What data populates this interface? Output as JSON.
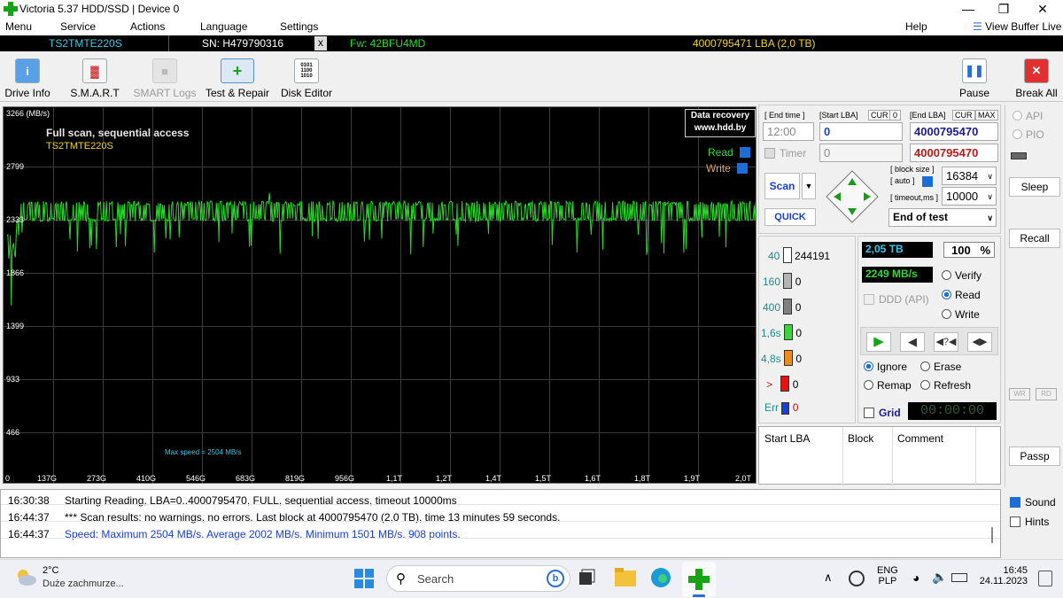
{
  "window": {
    "title": "Victoria 5.37 HDD/SSD | Device 0"
  },
  "menu": {
    "items": [
      "Menu",
      "Service",
      "Actions",
      "Language",
      "Settings"
    ],
    "help": "Help",
    "view_buffer": "View Buffer Live"
  },
  "device": {
    "model": "TS2TMTE220S",
    "serial": "SN: H479790316",
    "close": "x",
    "firmware": "Fw: 42BFU4MD",
    "capacity": "4000795471 LBA (2,0 TB)"
  },
  "toolbar": {
    "drive_info": "Drive Info",
    "smart": "S.M.A.R.T",
    "smart_logs": "SMART Logs",
    "test_repair": "Test & Repair",
    "disk_editor": "Disk Editor",
    "pause": "Pause",
    "break_all": "Break All"
  },
  "graph": {
    "unit_label": "3266 (MB/s)",
    "title": "Full scan, sequential access",
    "device": "TS2TMTE220S",
    "ad_line1": "Data recovery",
    "ad_line2": "www.hdd.by",
    "read_label": "Read",
    "write_label": "Write",
    "max_speed": "Max speed = 2504 MB/s",
    "y_ticks": [
      "2799",
      "2333",
      "1866",
      "1399",
      "933",
      "466"
    ],
    "x_ticks": [
      "0",
      "137G",
      "273G",
      "410G",
      "546G",
      "683G",
      "819G",
      "956G",
      "1,1T",
      "1,2T",
      "1,4T",
      "1,5T",
      "1,6T",
      "1,8T",
      "1,9T",
      "2,0T"
    ]
  },
  "chart_data": {
    "type": "line",
    "title": "Full scan, sequential access",
    "ylabel": "MB/s",
    "ylim": [
      0,
      3266
    ],
    "xlabel": "",
    "series": [
      {
        "name": "Read",
        "typical_min": 2250,
        "typical_max": 2430,
        "min": 1501,
        "max": 2504,
        "average": 2002,
        "points": 908
      }
    ]
  },
  "controls": {
    "end_time_label": "[ End time ]",
    "start_lba_label": "[Start LBA]",
    "cur_label": "CUR",
    "cur_value": "0",
    "end_lba_label": "[End LBA]",
    "cur2_label": "CUR",
    "max_label": "MAX",
    "end_time": "12:00",
    "start_lba": "0",
    "end_lba": "4000795470",
    "timer_label": "Timer",
    "timer_value": "0",
    "end_lba2": "4000795470",
    "block_size_label": "[ block size ]",
    "auto_label": "[ auto ]",
    "block_size": "16384",
    "timeout_label": "[ timeout,ms ]",
    "timeout": "10000",
    "scan_button": "Scan",
    "quick_button": "QUICK",
    "end_mode": "End of test"
  },
  "stats": {
    "rows": [
      {
        "label": "40",
        "count": "244191",
        "color": "#ffffff"
      },
      {
        "label": "160",
        "count": "0",
        "color": "#b4b4b4"
      },
      {
        "label": "400",
        "count": "0",
        "color": "#808080"
      },
      {
        "label": "1,6s",
        "count": "0",
        "color": "#39d639"
      },
      {
        "label": "4,8s",
        "count": "0",
        "color": "#f08a1c"
      },
      {
        "label": ">",
        "count": "0",
        "color": "#e81010"
      },
      {
        "label": "Err",
        "count": "0",
        "color": "#1a3fd6"
      }
    ],
    "size": "2,05 TB",
    "percent": "100",
    "percent_sign": "%",
    "speed": "2249 MB/s",
    "ddd_label": "DDD (API)",
    "verify": "Verify",
    "read": "Read",
    "write": "Write",
    "ignore": "Ignore",
    "erase": "Erase",
    "remap": "Remap",
    "refresh": "Refresh",
    "grid_label": "Grid",
    "timer": "00:00:00"
  },
  "table": {
    "headers": [
      "Start LBA",
      "Block",
      "Comment"
    ]
  },
  "side": {
    "api": "API",
    "pio": "PIO",
    "sleep": "Sleep",
    "recall": "Recall",
    "wr": "WR",
    "rd": "RD",
    "passp": "Passp",
    "sound": "Sound",
    "hints": "Hints"
  },
  "log": [
    {
      "time": "16:30:38",
      "text": "Starting Reading, LBA=0..4000795470, FULL, sequential access, timeout 10000ms",
      "color": "#000000"
    },
    {
      "time": "16:44:37",
      "text": "*** Scan results: no warnings, no errors. Last block at 4000795470 (2,0 TB), time 13 minutes 59 seconds.",
      "color": "#000000"
    },
    {
      "time": "16:44:37",
      "text": "Speed: Maximum 2504 MB/s. Average 2002 MB/s. Minimum 1501 MB/s. 908 points.",
      "color": "#1a3fd6"
    }
  ],
  "taskbar": {
    "temp": "2°C",
    "weather": "Duże zachmurze...",
    "search": "Search",
    "lang1": "ENG",
    "lang2": "PLP",
    "time": "16:45",
    "date": "24.11.2023"
  }
}
